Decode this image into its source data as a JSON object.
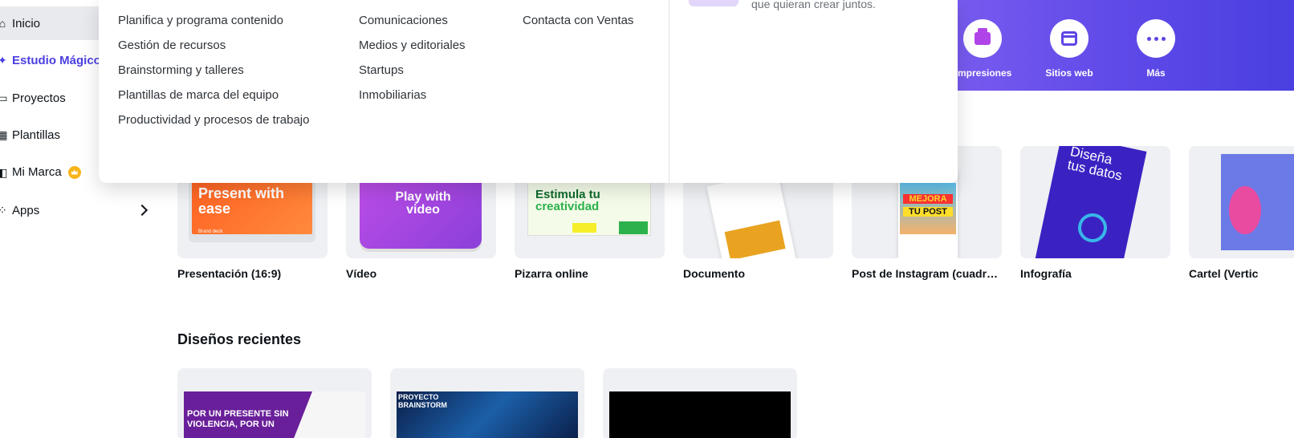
{
  "sidebar": {
    "items": [
      {
        "label": "Inicio",
        "icon": "home-icon"
      },
      {
        "label": "Estudio Mágico",
        "icon": "magic-icon"
      },
      {
        "label": "Proyectos",
        "icon": "folder-icon"
      },
      {
        "label": "Plantillas",
        "icon": "template-icon"
      },
      {
        "label": "Mi Marca",
        "icon": "brand-icon"
      },
      {
        "label": "Apps",
        "icon": "apps-icon"
      }
    ]
  },
  "dropdown": {
    "col1": [
      "Planifica y programa contenido",
      "Gestión de recursos",
      "Brainstorming y talleres",
      "Plantillas de marca del equipo",
      "Productividad y procesos de trabajo"
    ],
    "col2": [
      "Comunicaciones",
      "Medios y editoriales",
      "Startups",
      "Inmobiliarias"
    ],
    "col3": [
      "Contacta con Ventas"
    ],
    "promo_text": "que quieran crear juntos."
  },
  "hero": {
    "buttons": [
      {
        "label": "Impresiones",
        "icon": "printer-icon"
      },
      {
        "label": "Sitios web",
        "icon": "website-icon"
      },
      {
        "label": "Más",
        "icon": "more-icon"
      }
    ],
    "color_start": "#7b5cf0",
    "color_end": "#4a3fe0"
  },
  "templates": [
    {
      "label": "Presentación (16:9)",
      "thumb_text": "Present with ease",
      "thumb_sub": "Brand deck"
    },
    {
      "label": "Vídeo",
      "thumb_text": "Play with video"
    },
    {
      "label": "Pizarra online",
      "thumb_text": "Estimula tu",
      "thumb_text2": "creatividad"
    },
    {
      "label": "Documento"
    },
    {
      "label": "Post de Instagram (cuadra...",
      "thumb_text": "MEJORA",
      "thumb_text2": "TU POST"
    },
    {
      "label": "Infografía",
      "thumb_text": "Diseña tus datos"
    },
    {
      "label": "Cartel (Vertic"
    }
  ],
  "recent": {
    "title": "Diseños recientes",
    "items": [
      {
        "thumb_text": "POR UN PRESENTE SIN VIOLENCIA, POR UN"
      },
      {
        "thumb_text": "PROYECTO BRAINSTORM"
      },
      {
        "thumb_text": ""
      }
    ]
  }
}
